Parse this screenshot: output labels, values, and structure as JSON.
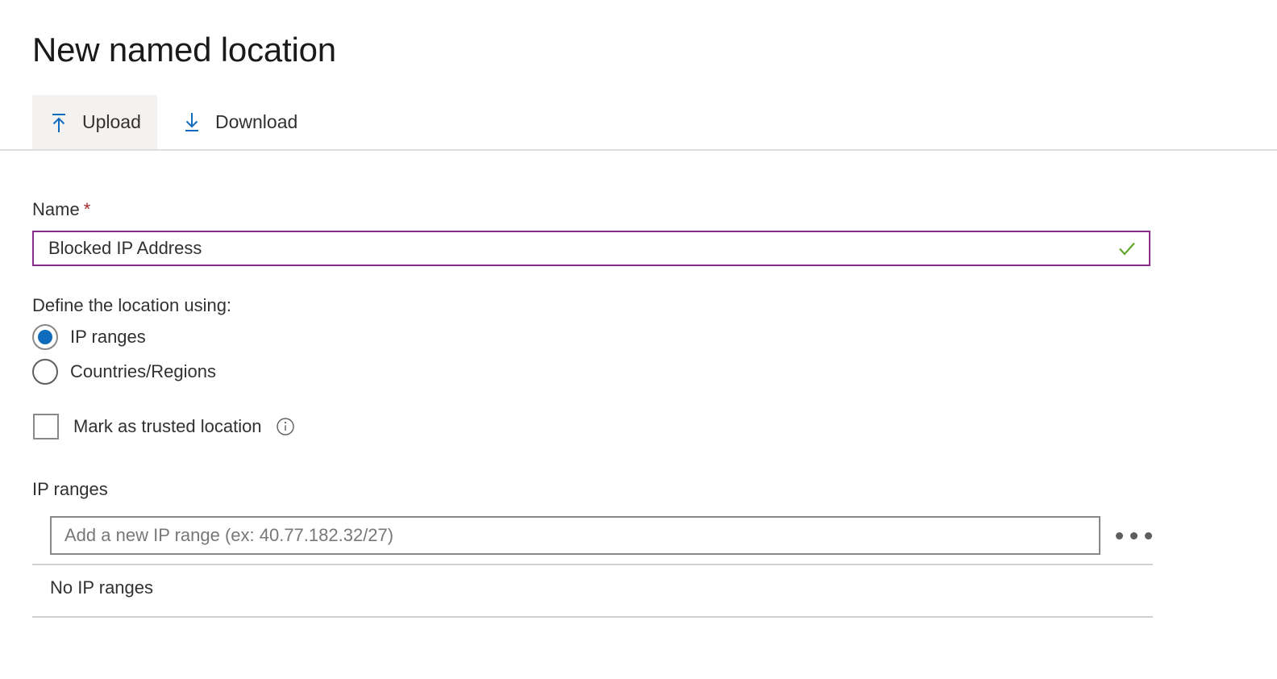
{
  "page": {
    "title": "New named location"
  },
  "toolbar": {
    "buttons": [
      {
        "label": "Upload",
        "icon": "upload-icon",
        "active": true
      },
      {
        "label": "Download",
        "icon": "download-icon",
        "active": false
      }
    ]
  },
  "form": {
    "name": {
      "label": "Name",
      "required_marker": "*",
      "value": "Blocked IP Address",
      "placeholder": "",
      "validation_icon": "checkmark-icon",
      "valid": true
    },
    "define_using": {
      "label": "Define the location using:",
      "options": [
        {
          "label": "IP ranges",
          "selected": true
        },
        {
          "label": "Countries/Regions",
          "selected": false
        }
      ]
    },
    "trusted": {
      "label": "Mark as trusted location",
      "checked": false,
      "info_icon": "info-icon"
    },
    "ip_ranges": {
      "label": "IP ranges",
      "input_value": "",
      "input_placeholder": "Add a new IP range (ex: 40.77.182.32/27)",
      "more_button_icon": "ellipsis-icon",
      "empty_message": "No IP ranges"
    }
  },
  "colors": {
    "accent_blue": "#0f6cbd",
    "focus_border": "#8a2b8a",
    "valid_green": "#5fa72a",
    "required_red": "#a4262c",
    "text_primary": "#323130",
    "divider": "#d2d0ce",
    "toolbar_active_bg": "#f3f2f1"
  }
}
